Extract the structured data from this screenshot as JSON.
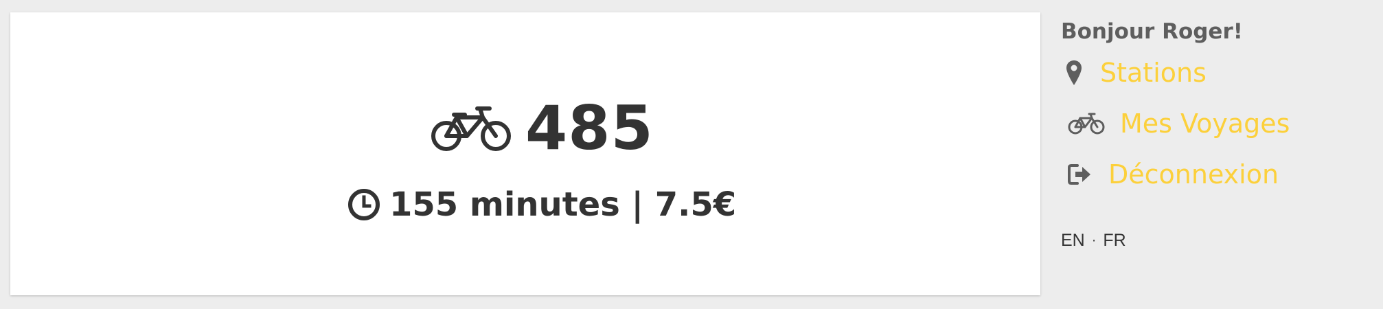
{
  "trips": {
    "count": "485",
    "bike_icon": "bicycle-icon",
    "clock_icon": "clock-icon",
    "stats": "155 minutes | 7.5€"
  },
  "sidebar": {
    "greeting": "Bonjour Roger!",
    "nav": [
      {
        "label": "Stations",
        "icon": "map-marker-icon"
      },
      {
        "label": "Mes Voyages",
        "icon": "bicycle-icon"
      },
      {
        "label": "Déconnexion",
        "icon": "sign-out-icon"
      }
    ],
    "languages": [
      "EN",
      "FR"
    ],
    "separator": "·"
  },
  "colors": {
    "accent": "#fcd03b",
    "text_dark": "#333333",
    "text_grey": "#5e5e5e",
    "background": "#ededed",
    "card": "#ffffff"
  }
}
